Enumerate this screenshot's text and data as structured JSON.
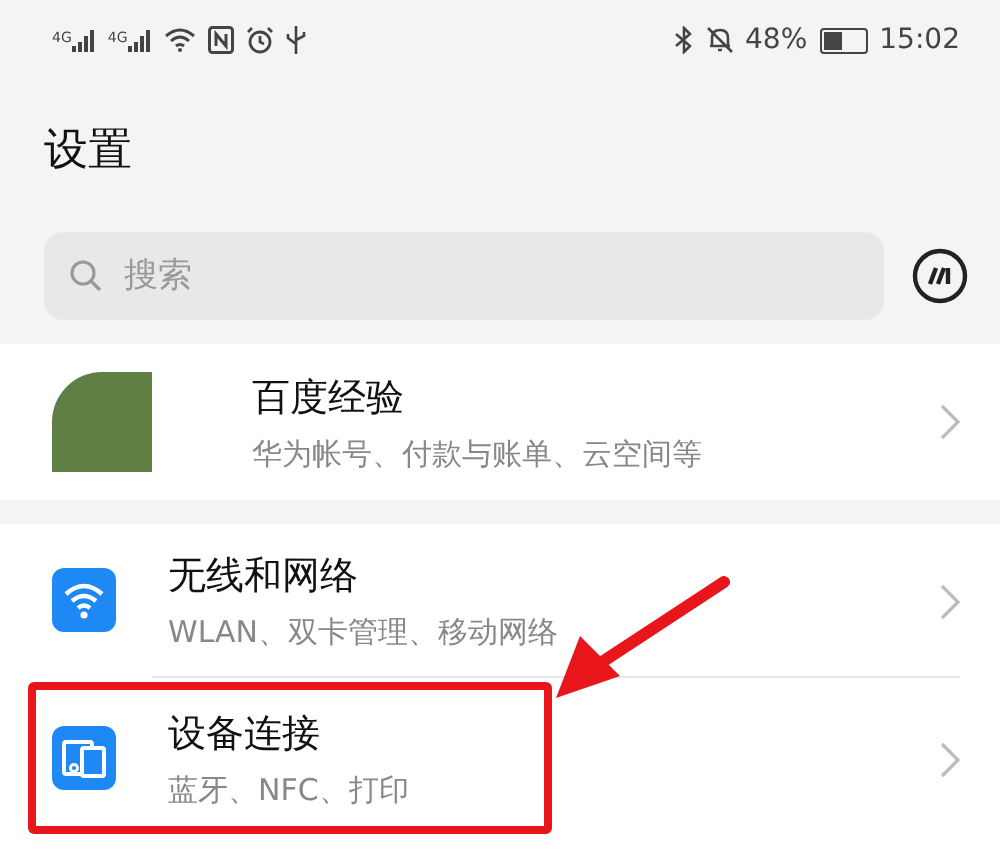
{
  "status_bar": {
    "networks": [
      {
        "label": "4G"
      },
      {
        "label": "4G"
      }
    ],
    "battery_text": "48%",
    "battery": {
      "level": 0.48
    },
    "time": "15:02"
  },
  "title": "设置",
  "search": {
    "placeholder": "搜索"
  },
  "account": {
    "name": "百度经验",
    "subtitle": "华为帐号、付款与账单、云空间等"
  },
  "settings": [
    {
      "kind": "wifi",
      "title": "无线和网络",
      "subtitle": "WLAN、双卡管理、移动网络",
      "highlighted": false
    },
    {
      "kind": "devices",
      "title": "设备连接",
      "subtitle": "蓝牙、NFC、打印",
      "highlighted": true
    }
  ]
}
